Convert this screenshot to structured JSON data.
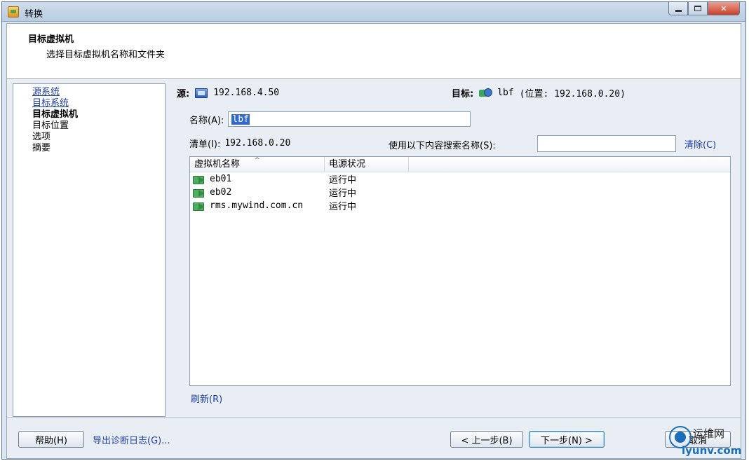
{
  "window": {
    "title": "转换"
  },
  "header": {
    "title": "目标虚拟机",
    "subtitle": "选择目标虚拟机名称和文件夹"
  },
  "nav": {
    "items": [
      {
        "label": "源系统",
        "state": "link"
      },
      {
        "label": "目标系统",
        "state": "link"
      },
      {
        "label": "目标虚拟机",
        "state": "current"
      },
      {
        "label": "目标位置",
        "state": "normal"
      },
      {
        "label": "选项",
        "state": "normal"
      },
      {
        "label": "摘要",
        "state": "normal"
      }
    ]
  },
  "source": {
    "label": "源:",
    "icon": "computer-icon",
    "address": "192.168.4.50"
  },
  "target": {
    "label": "目标:",
    "icon": "vm-host-icon",
    "name": "lbf",
    "location": "(位置: 192.168.0.20)"
  },
  "name_field": {
    "label": "名称(A):",
    "value": "lbf"
  },
  "inventory": {
    "label": "清单(I):",
    "value": "192.168.0.20"
  },
  "search": {
    "label": "使用以下内容搜索名称(S):",
    "value": "",
    "clear_label": "清除(C)"
  },
  "vm_table": {
    "columns": [
      "虚拟机名称",
      "电源状况"
    ],
    "rows": [
      {
        "name": "eb01",
        "power": "运行中"
      },
      {
        "name": "eb02",
        "power": "运行中"
      },
      {
        "name": "rms.mywind.com.cn",
        "power": "运行中"
      }
    ]
  },
  "refresh_label": "刷新(R)",
  "footer": {
    "help_label": "帮助(H)",
    "export_label": "导出诊断日志(G)...",
    "back_label": "< 上一步(B)",
    "next_label": "下一步(N) >",
    "cancel_label": "取消"
  },
  "watermark": {
    "text_cn": "运维网",
    "text_en": "iyunv.com"
  },
  "colors": {
    "link": "#1f3ea8",
    "selection": "#3169c6"
  }
}
